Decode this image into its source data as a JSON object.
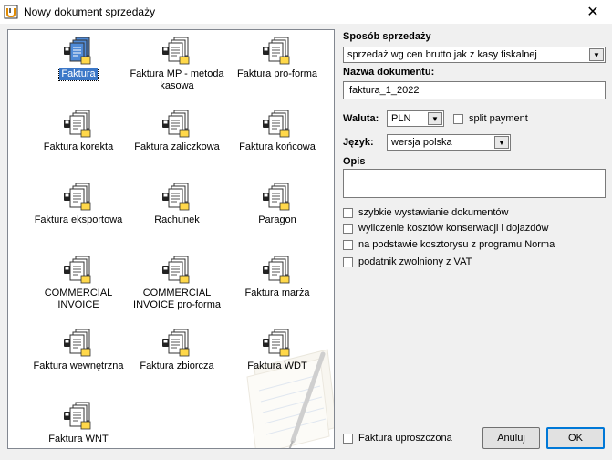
{
  "window": {
    "title": "Nowy dokument sprzedaży",
    "close_glyph": "✕"
  },
  "documents": [
    {
      "label": "Faktura",
      "selected": true
    },
    {
      "label": "Faktura MP - metoda\nkasowa",
      "selected": false
    },
    {
      "label": "Faktura pro-forma",
      "selected": false
    },
    {
      "label": "Faktura korekta",
      "selected": false
    },
    {
      "label": "Faktura zaliczkowa",
      "selected": false
    },
    {
      "label": "Faktura końcowa",
      "selected": false
    },
    {
      "label": "Faktura eksportowa",
      "selected": false
    },
    {
      "label": "Rachunek",
      "selected": false
    },
    {
      "label": "Paragon",
      "selected": false
    },
    {
      "label": "COMMERCIAL\nINVOICE",
      "selected": false
    },
    {
      "label": "COMMERCIAL\nINVOICE pro-forma",
      "selected": false
    },
    {
      "label": "Faktura marża",
      "selected": false
    },
    {
      "label": "Faktura wewnętrzna",
      "selected": false
    },
    {
      "label": "Faktura zbiorcza",
      "selected": false
    },
    {
      "label": "Faktura WDT",
      "selected": false
    },
    {
      "label": "Faktura WNT",
      "selected": false
    }
  ],
  "form": {
    "sales_method_label": "Sposób sprzedaży",
    "sales_method_value": "sprzedaż wg cen brutto jak z kasy fiskalnej",
    "doc_name_label": "Nazwa dokumentu:",
    "doc_name_value": "faktura_1_2022",
    "currency_label": "Waluta:",
    "currency_value": "PLN",
    "split_payment_label": "split payment",
    "language_label": "Język:",
    "language_value": "wersja polska",
    "description_label": "Opis",
    "description_value": "",
    "options": [
      "szybkie wystawianie dokumentów",
      "wyliczenie kosztów konserwacji i dojazdów",
      "na podstawie kosztorysu z programu Norma",
      "podatnik zwolniony z VAT"
    ],
    "simplified_invoice_label": "Faktura uproszczona"
  },
  "buttons": {
    "cancel_label": "Anuluj",
    "ok_label": "OK"
  },
  "colors": {
    "selection": "#3c78c8",
    "ok_border": "#0078d7"
  }
}
